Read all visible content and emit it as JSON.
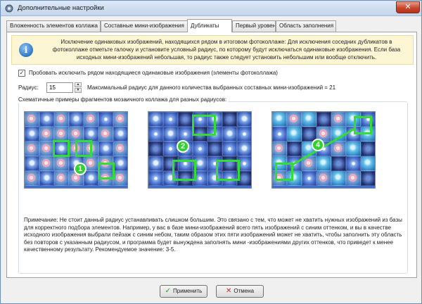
{
  "window": {
    "title": "Дополнительные настройки",
    "close_symbol": "✕"
  },
  "tabs": [
    {
      "label": "Вложенность элементов коллажа",
      "active": false
    },
    {
      "label": "Составные мини-изображения",
      "active": false
    },
    {
      "label": "Дубликаты",
      "active": true
    },
    {
      "label": "Первый уровень",
      "active": false
    },
    {
      "label": "Область заполнения",
      "active": false
    }
  ],
  "info": {
    "icon": "info-icon",
    "icon_glyph": "i",
    "text": "Исключение одинаковых изображений, находящихся рядом в итоговом фотоколлаже: Для исключения соседних дубликатов в фотоколлаже отметьте галочку и установите условный радиус, по которому будут исключаться одинаковые изображения. Если база исходных мини-изображений небольшая, то радиус также следует установить небольшим или вообще отключить."
  },
  "exclude_duplicates": {
    "checked": true,
    "check_glyph": "✓",
    "label": "Пробовать исключить рядом находящиеся одинаковые изображения (элементы фотоколлажа)"
  },
  "radius": {
    "label": "Радиус:",
    "value": "15",
    "max_text": "Максимальный радиус для данного количества выбранных составных мини-изображений = 21",
    "up_glyph": "▲",
    "down_glyph": "▼"
  },
  "examples": {
    "group_title": "Схематичные примеры фрагментов мозаичного коллажа для разных радиусов:",
    "items": [
      {
        "badge": "1"
      },
      {
        "badge": "2"
      },
      {
        "badge": "4"
      }
    ]
  },
  "note": {
    "text": "Примечание: Не стоит данный радиус устанавливать слишком большим. Это связано с тем, что может не хватить нужных изображений из базы для корректного подбора элементов. Например, у вас в базе мини-изображений всего пять изображений с синим оттенком, и вы в качестве исходного изображения выбрали пейзаж с синим небом, таким образом этих пяти изображений может не хватить, чтобы заполнить эту область без повторов с указанным радиусом, и программа будет вынуждена заполнять мини -изображениями других оттенков, что приведет к менее качественному результату. Рекомендуемое значение: 3-5."
  },
  "buttons": {
    "apply": {
      "label": "Применить",
      "icon_glyph": "✓"
    },
    "cancel": {
      "label": "Отмена",
      "icon_glyph": "✕"
    }
  },
  "colors": {
    "selection": "#33dd33",
    "info_bg": "#fdf6d5",
    "titlebar": "#c3d6ec"
  }
}
